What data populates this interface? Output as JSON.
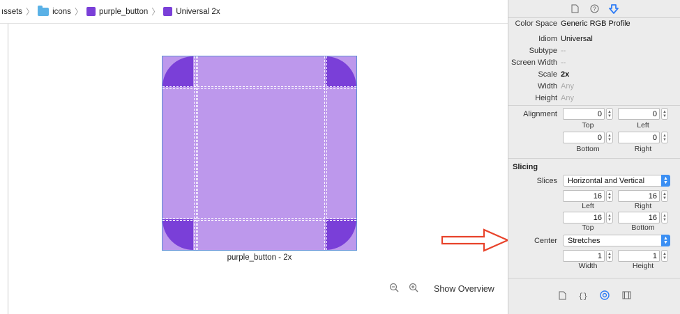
{
  "breadcrumb": {
    "items": [
      {
        "label": "ıssets",
        "icon": "none"
      },
      {
        "label": "icons",
        "icon": "folder-icon"
      },
      {
        "label": "purple_button",
        "icon": "image-set-icon"
      },
      {
        "label": "Universal 2x",
        "icon": "image-set-icon"
      }
    ],
    "separator": "〉"
  },
  "canvas": {
    "caption": "purple_button - 2x",
    "zoom_out_icon": "−",
    "zoom_in_icon": "+",
    "show_overview": "Show Overview"
  },
  "colors": {
    "slice_fill": "#bd98ec",
    "corner_fill": "#7a3fd8",
    "accent": "#3b8ff3",
    "arrow": "#e8432b"
  },
  "inspector": {
    "toolbar_icons": [
      "file-icon",
      "help-icon",
      "attributes-icon"
    ],
    "color_space_label": "Color Space",
    "color_space_value": "Generic RGB Profile",
    "idiom_label": "Idiom",
    "idiom_value": "Universal",
    "subtype_label": "Subtype",
    "subtype_value": "--",
    "screen_width_label": "Screen Width",
    "screen_width_value": "--",
    "scale_label": "Scale",
    "scale_value": "2x",
    "width_label": "Width",
    "width_value": "Any",
    "height_label": "Height",
    "height_value": "Any",
    "alignment": {
      "label": "Alignment",
      "top": "0",
      "left": "0",
      "bottom": "0",
      "right": "0",
      "top_label": "Top",
      "left_label": "Left",
      "bottom_label": "Bottom",
      "right_label": "Right"
    },
    "slicing": {
      "title": "Slicing",
      "slices_label": "Slices",
      "slices_value": "Horizontal and Vertical",
      "left": "16",
      "right": "16",
      "top": "16",
      "bottom": "16",
      "left_label": "Left",
      "right_label": "Right",
      "top_label": "Top",
      "bottom_label": "Bottom",
      "center_label": "Center",
      "center_value": "Stretches",
      "center_width": "1",
      "center_height": "1",
      "width_label": "Width",
      "height_label": "Height"
    },
    "bottom_icons": [
      "file-template-icon",
      "code-snippet-icon",
      "object-library-icon",
      "media-library-icon"
    ]
  }
}
